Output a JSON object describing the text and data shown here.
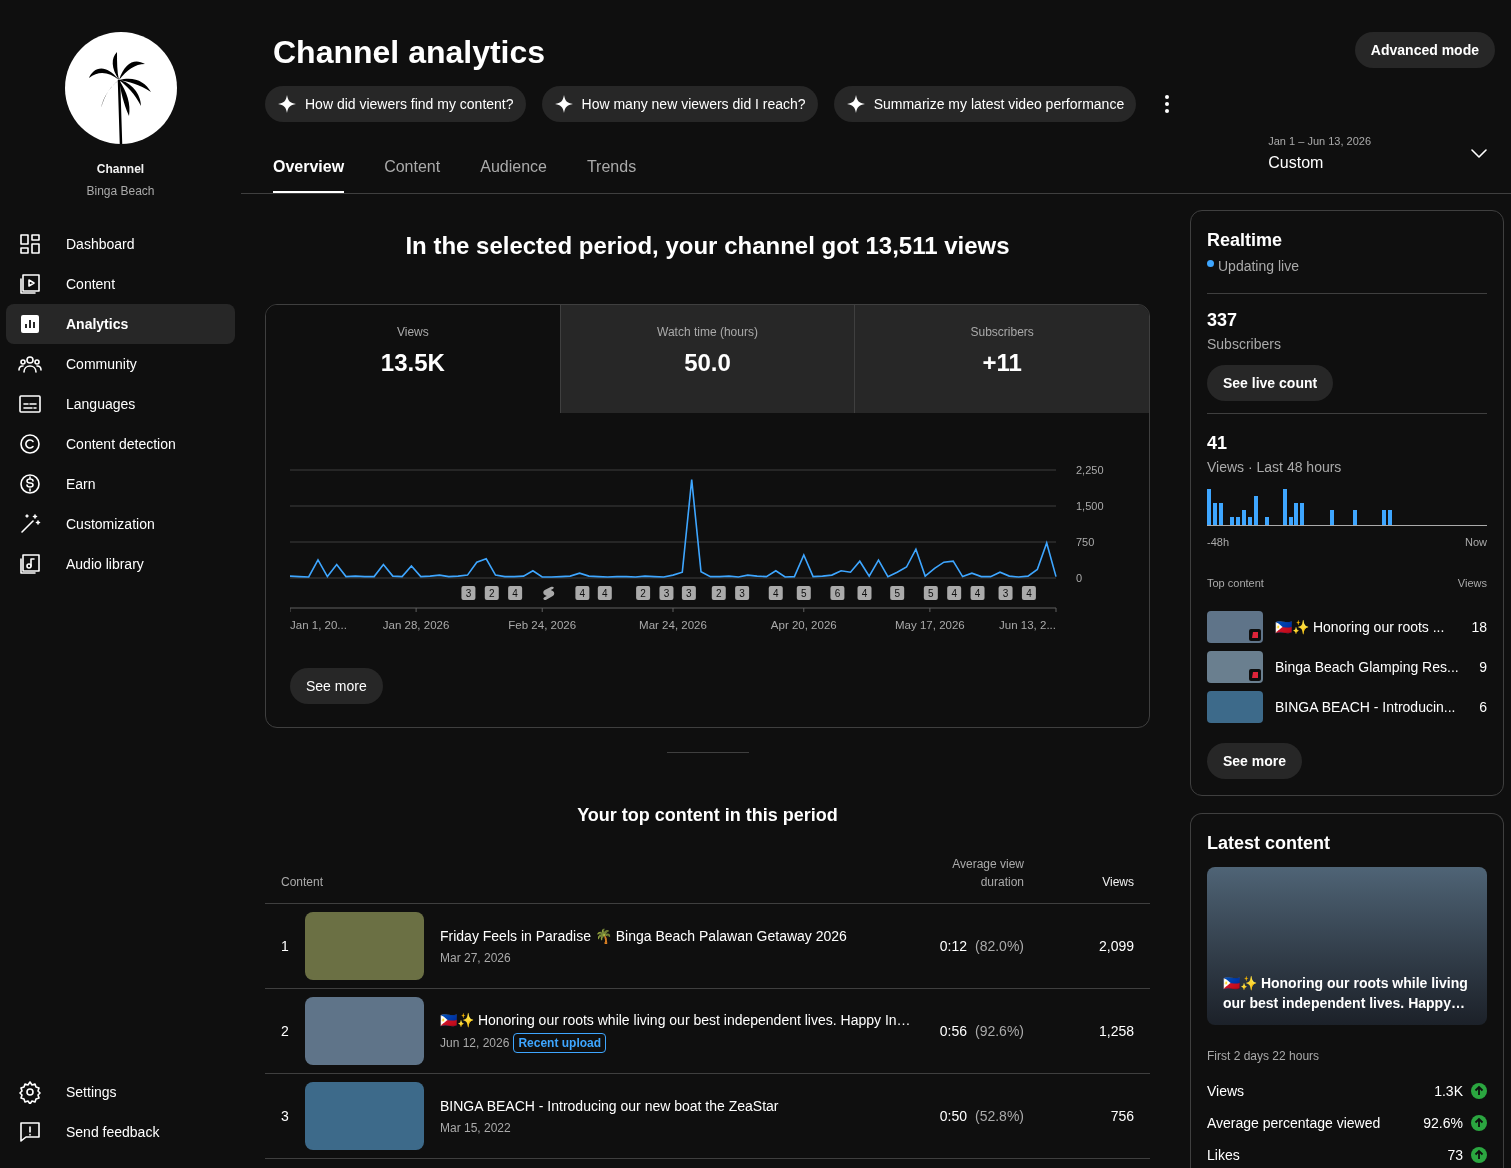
{
  "channel": {
    "label": "Channel",
    "name": "Binga Beach"
  },
  "sidebar": {
    "items": [
      {
        "label": "Dashboard",
        "selected": false
      },
      {
        "label": "Content",
        "selected": false
      },
      {
        "label": "Analytics",
        "selected": true
      },
      {
        "label": "Community",
        "selected": false
      },
      {
        "label": "Languages",
        "selected": false
      },
      {
        "label": "Content detection",
        "selected": false
      },
      {
        "label": "Earn",
        "selected": false
      },
      {
        "label": "Customization",
        "selected": false
      },
      {
        "label": "Audio library",
        "selected": false
      }
    ],
    "bottom_items": [
      {
        "label": "Settings"
      },
      {
        "label": "Send feedback"
      }
    ]
  },
  "header": {
    "title": "Channel analytics",
    "advanced_button": "Advanced mode",
    "suggestions": [
      "How did viewers find my content?",
      "How many new viewers did I reach?",
      "Summarize my latest video performance"
    ]
  },
  "tabs": [
    {
      "label": "Overview",
      "selected": true
    },
    {
      "label": "Content",
      "selected": false
    },
    {
      "label": "Audience",
      "selected": false
    },
    {
      "label": "Trends",
      "selected": false
    }
  ],
  "date_range": {
    "range": "Jan 1 – Jun 13, 2026",
    "preset": "Custom"
  },
  "headline": "In the selected period, your channel got 13,511 views",
  "metrics": [
    {
      "label": "Views",
      "value": "13.5K",
      "selected": true
    },
    {
      "label": "Watch time (hours)",
      "value": "50.0",
      "selected": false
    },
    {
      "label": "Subscribers",
      "value": "+11",
      "selected": false
    }
  ],
  "x_labels": [
    "Jan 1, 20...",
    "Jan 28, 2026",
    "Feb 24, 2026",
    "Mar 24, 2026",
    "Apr 20, 2026",
    "May 17, 2026",
    "Jun 13, 2..."
  ],
  "upload_markers": [
    {
      "kind": "count",
      "label": "3"
    },
    {
      "kind": "count",
      "label": "2"
    },
    {
      "kind": "count",
      "label": "4"
    },
    {
      "kind": "shorts"
    },
    {
      "kind": "count",
      "label": "4"
    },
    {
      "kind": "count",
      "label": "4"
    },
    {
      "kind": "count",
      "label": "2"
    },
    {
      "kind": "count",
      "label": "3"
    },
    {
      "kind": "count",
      "label": "3"
    },
    {
      "kind": "count",
      "label": "2"
    },
    {
      "kind": "count",
      "label": "3"
    },
    {
      "kind": "count",
      "label": "4"
    },
    {
      "kind": "count",
      "label": "5"
    },
    {
      "kind": "count",
      "label": "6"
    },
    {
      "kind": "count",
      "label": "4"
    },
    {
      "kind": "count",
      "label": "5"
    },
    {
      "kind": "count",
      "label": "5"
    },
    {
      "kind": "count",
      "label": "4"
    },
    {
      "kind": "count",
      "label": "4"
    },
    {
      "kind": "count",
      "label": "3"
    },
    {
      "kind": "count",
      "label": "4"
    }
  ],
  "chart_data": {
    "type": "line",
    "ylim": [
      0,
      2250
    ],
    "yticks": [
      {
        "value": 0,
        "label": "0"
      },
      {
        "value": 750,
        "label": "750"
      },
      {
        "value": 1500,
        "label": "1,500"
      },
      {
        "value": 2250,
        "label": "2,250"
      }
    ],
    "series": [
      {
        "color": "#3ea6ff",
        "values": [
          40,
          30,
          20,
          380,
          30,
          280,
          30,
          40,
          30,
          30,
          280,
          40,
          30,
          250,
          30,
          40,
          60,
          30,
          40,
          60,
          330,
          400,
          60,
          30,
          30,
          40,
          150,
          20,
          20,
          30,
          40,
          100,
          40,
          30,
          20,
          30,
          30,
          20,
          40,
          30,
          20,
          60,
          120,
          2050,
          130,
          30,
          30,
          40,
          20,
          60,
          40,
          30,
          150,
          20,
          30,
          480,
          30,
          40,
          60,
          150,
          120,
          350,
          40,
          370,
          30,
          120,
          230,
          600,
          40,
          200,
          330,
          350,
          30,
          100,
          30,
          30,
          120,
          40,
          20,
          40,
          180,
          730,
          30
        ]
      }
    ]
  },
  "see_more": "See more",
  "top_content": {
    "title": "Your top content in this period",
    "columns": [
      "Content",
      "Average view duration",
      "Views"
    ],
    "rows": [
      {
        "rank": "1",
        "title": "Friday Feels in Paradise 🌴 Binga Beach Palawan Getaway 2026",
        "date": "Mar 27, 2026",
        "duration": "0:12",
        "percent": "(82.0%)",
        "views": "2,099"
      },
      {
        "rank": "2",
        "title": "🇵🇭✨ Honoring our roots while living our best independent lives. Happy In…",
        "date": "Jun 12, 2026",
        "badge": "Recent upload",
        "duration": "0:56",
        "percent": "(92.6%)",
        "views": "1,258"
      },
      {
        "rank": "3",
        "title": "BINGA BEACH - Introducing our new boat the ZeaStar",
        "date": "Mar 15, 2022",
        "duration": "0:50",
        "percent": "(52.8%)",
        "views": "756"
      }
    ]
  },
  "realtime": {
    "title": "Realtime",
    "status": "Updating live",
    "subscribers": "337",
    "subscribers_label": "Subscribers",
    "live_button": "See live count",
    "views": "41",
    "views_label": "Views · Last 48 hours",
    "axis_start": "-48h",
    "axis_end": "Now",
    "top_label": "Top content",
    "top_views_label": "Views",
    "items": [
      {
        "title": "🇵🇭✨ Honoring our roots ...",
        "views": "18",
        "short": true
      },
      {
        "title": "Binga Beach Glamping Res...",
        "views": "9",
        "short": true
      },
      {
        "title": "BINGA BEACH - Introducin...",
        "views": "6",
        "short": false
      }
    ],
    "see_more": "See more"
  },
  "latest": {
    "title": "Latest content",
    "video_title": "🇵🇭✨ Honoring our roots while living our best independent lives. Happy…",
    "period": "First 2 days 22 hours",
    "stats": [
      {
        "label": "Views",
        "value": "1.3K",
        "increased": true
      },
      {
        "label": "Average percentage viewed",
        "value": "92.6%",
        "increased": true
      },
      {
        "label": "Likes",
        "value": "73",
        "increased": true
      }
    ]
  }
}
